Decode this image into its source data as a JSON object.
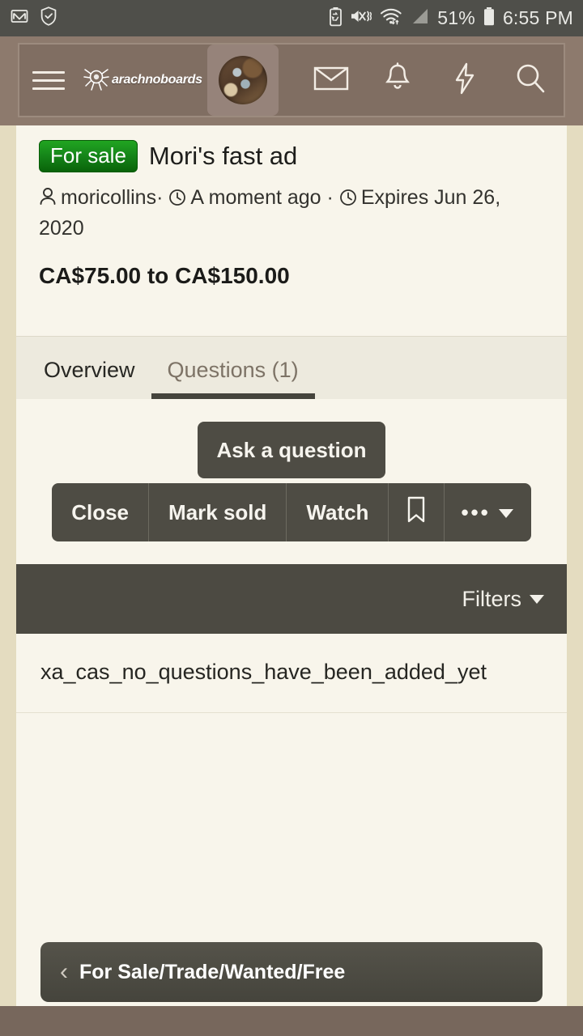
{
  "status_bar": {
    "left_icons": [
      "gmail-icon",
      "shield-check-icon"
    ],
    "right_icons": [
      "battery-saver-icon",
      "mute-vibrate-icon",
      "wifi-icon",
      "signal-icon"
    ],
    "battery_percent": "51%",
    "time": "6:55 PM",
    "background": "#4f4f4a"
  },
  "app_nav": {
    "menu_icon": "hamburger-icon",
    "brand": "arachnoboards",
    "avatar": "user-avatar",
    "icons": [
      "envelope-icon",
      "bell-icon",
      "bolt-icon",
      "search-icon"
    ],
    "background": "#806e62"
  },
  "listing": {
    "badge": "For sale",
    "badge_color": "#16871a",
    "title": "Mori's fast ad",
    "author": "moricollins",
    "separator": "·",
    "posted": "A moment ago",
    "expires": "Expires Jun 26, 2020",
    "price": "CA$75.00 to CA$150.00"
  },
  "tabs": [
    {
      "label": "Overview",
      "active": false
    },
    {
      "label": "Questions (1)",
      "active": true
    }
  ],
  "actions": {
    "ask": "Ask a question",
    "close": "Close",
    "mark_sold": "Mark sold",
    "watch": "Watch",
    "bookmark_icon": "bookmark-icon",
    "more_icon": "ellipsis-icon"
  },
  "filter_bar": {
    "label": "Filters",
    "caret": "chevron-down-icon",
    "background": "#4c4a42"
  },
  "questions": {
    "empty_message": "xa_cas_no_questions_have_been_added_yet"
  },
  "breadcrumb": {
    "back_icon": "chevron-left-icon",
    "label": "For Sale/Trade/Wanted/Free"
  }
}
